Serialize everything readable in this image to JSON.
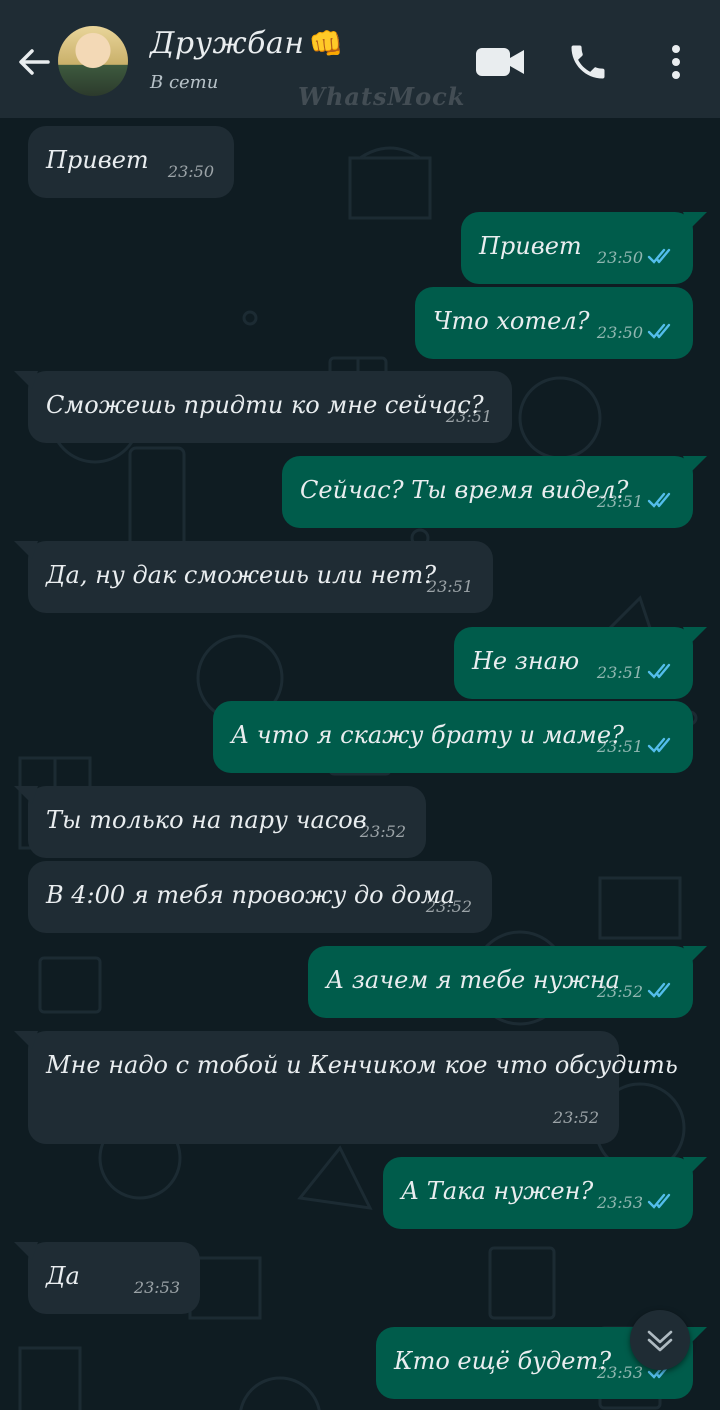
{
  "header": {
    "contact_name": "Дружбан",
    "name_emoji": "👊",
    "status": "В сети",
    "watermark": "WhatsMock"
  },
  "colors": {
    "header_bg": "#1f2c34",
    "incoming_bubble": "#1f2c34",
    "outgoing_bubble": "#005c4b",
    "read_ticks": "#53bdeb",
    "wallpaper": "#0f1c22"
  },
  "messages": [
    {
      "direction": "in",
      "text": "Привет",
      "time": "23:50"
    },
    {
      "direction": "out",
      "text": "Привет",
      "time": "23:50",
      "status": "read"
    },
    {
      "direction": "out",
      "text": "Что хотел?",
      "time": "23:50",
      "status": "read"
    },
    {
      "direction": "in",
      "text": "Сможешь придти ко мне сейчас?",
      "time": "23:51"
    },
    {
      "direction": "out",
      "text": "Сейчас? Ты время видел?",
      "time": "23:51",
      "status": "read"
    },
    {
      "direction": "in",
      "text": "Да, ну дак сможешь или нет?",
      "time": "23:51"
    },
    {
      "direction": "out",
      "text": "Не знаю",
      "time": "23:51",
      "status": "read"
    },
    {
      "direction": "out",
      "text": "А что я скажу брату и маме?",
      "time": "23:51",
      "status": "read"
    },
    {
      "direction": "in",
      "text": "Ты только на пару часов",
      "time": "23:52"
    },
    {
      "direction": "in",
      "text": "В 4:00 я тебя провожу до дома",
      "time": "23:52"
    },
    {
      "direction": "out",
      "text": "А зачем я тебе нужна",
      "time": "23:52",
      "status": "read"
    },
    {
      "direction": "in",
      "text": "Мне надо с тобой и Кенчиком кое что обсудить",
      "time": "23:52"
    },
    {
      "direction": "out",
      "text": "А Така нужен?",
      "time": "23:53",
      "status": "read"
    },
    {
      "direction": "in",
      "text": "Да",
      "time": "23:53"
    },
    {
      "direction": "out",
      "text": "Кто ещё будет?",
      "time": "23:53",
      "status": "read"
    }
  ]
}
